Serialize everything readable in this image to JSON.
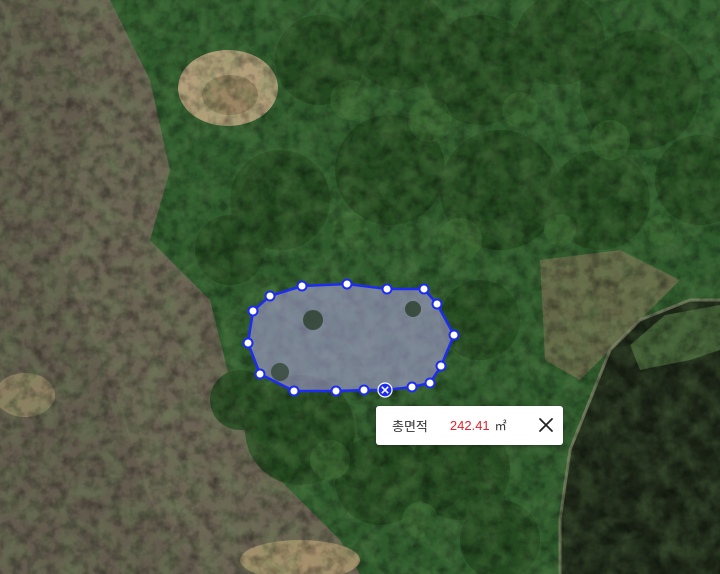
{
  "map": {
    "imagery": "satellite",
    "tool": "area-measurement"
  },
  "colors": {
    "polygon_stroke": "#1c2cf0",
    "polygon_fill": "#b5a6e6",
    "vertex_fill": "#ffffff",
    "value_text": "#e5202b"
  },
  "measurement": {
    "label": "총면적",
    "value": "242.41",
    "unit": "㎡"
  },
  "icons": {
    "close": "close-icon",
    "delete_polygon": "x-marker-icon"
  }
}
